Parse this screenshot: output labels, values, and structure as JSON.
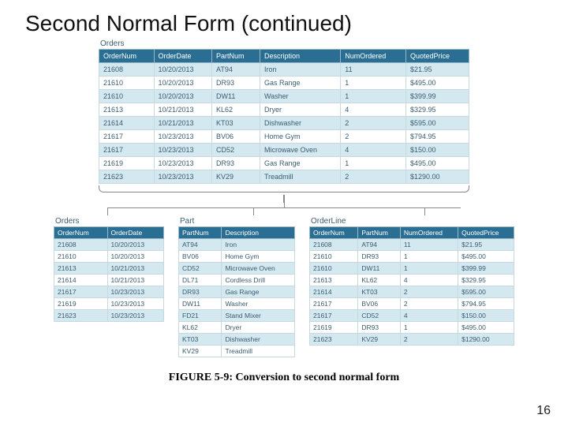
{
  "title": "Second Normal Form (continued)",
  "caption": "FIGURE 5-9: Conversion to second normal form",
  "page_number": "16",
  "top_table": {
    "label": "Orders",
    "headers": [
      "OrderNum",
      "OrderDate",
      "PartNum",
      "Description",
      "NumOrdered",
      "QuotedPrice"
    ],
    "rows": [
      [
        "21608",
        "10/20/2013",
        "AT94",
        "Iron",
        "11",
        "$21.95"
      ],
      [
        "21610",
        "10/20/2013",
        "DR93",
        "Gas Range",
        "1",
        "$495.00"
      ],
      [
        "21610",
        "10/20/2013",
        "DW11",
        "Washer",
        "1",
        "$399.99"
      ],
      [
        "21613",
        "10/21/2013",
        "KL62",
        "Dryer",
        "4",
        "$329.95"
      ],
      [
        "21614",
        "10/21/2013",
        "KT03",
        "Dishwasher",
        "2",
        "$595.00"
      ],
      [
        "21617",
        "10/23/2013",
        "BV06",
        "Home Gym",
        "2",
        "$794.95"
      ],
      [
        "21617",
        "10/23/2013",
        "CD52",
        "Microwave Oven",
        "4",
        "$150.00"
      ],
      [
        "21619",
        "10/23/2013",
        "DR93",
        "Gas Range",
        "1",
        "$495.00"
      ],
      [
        "21623",
        "10/23/2013",
        "KV29",
        "Treadmill",
        "2",
        "$1290.00"
      ]
    ]
  },
  "orders": {
    "label": "Orders",
    "headers": [
      "OrderNum",
      "OrderDate"
    ],
    "rows": [
      [
        "21608",
        "10/20/2013"
      ],
      [
        "21610",
        "10/20/2013"
      ],
      [
        "21613",
        "10/21/2013"
      ],
      [
        "21614",
        "10/21/2013"
      ],
      [
        "21617",
        "10/23/2013"
      ],
      [
        "21619",
        "10/23/2013"
      ],
      [
        "21623",
        "10/23/2013"
      ]
    ]
  },
  "part": {
    "label": "Part",
    "headers": [
      "PartNum",
      "Description"
    ],
    "rows": [
      [
        "AT94",
        "Iron"
      ],
      [
        "BV06",
        "Home Gym"
      ],
      [
        "CD52",
        "Microwave Oven"
      ],
      [
        "DL71",
        "Cordless Drill"
      ],
      [
        "DR93",
        "Gas Range"
      ],
      [
        "DW11",
        "Washer"
      ],
      [
        "FD21",
        "Stand Mixer"
      ],
      [
        "KL62",
        "Dryer"
      ],
      [
        "KT03",
        "Dishwasher"
      ],
      [
        "KV29",
        "Treadmill"
      ]
    ]
  },
  "orderline": {
    "label": "OrderLine",
    "headers": [
      "OrderNum",
      "PartNum",
      "NumOrdered",
      "QuotedPrice"
    ],
    "rows": [
      [
        "21608",
        "AT94",
        "11",
        "$21.95"
      ],
      [
        "21610",
        "DR93",
        "1",
        "$495.00"
      ],
      [
        "21610",
        "DW11",
        "1",
        "$399.99"
      ],
      [
        "21613",
        "KL62",
        "4",
        "$329.95"
      ],
      [
        "21614",
        "KT03",
        "2",
        "$595.00"
      ],
      [
        "21617",
        "BV06",
        "2",
        "$794.95"
      ],
      [
        "21617",
        "CD52",
        "4",
        "$150.00"
      ],
      [
        "21619",
        "DR93",
        "1",
        "$495.00"
      ],
      [
        "21623",
        "KV29",
        "2",
        "$1290.00"
      ]
    ]
  }
}
